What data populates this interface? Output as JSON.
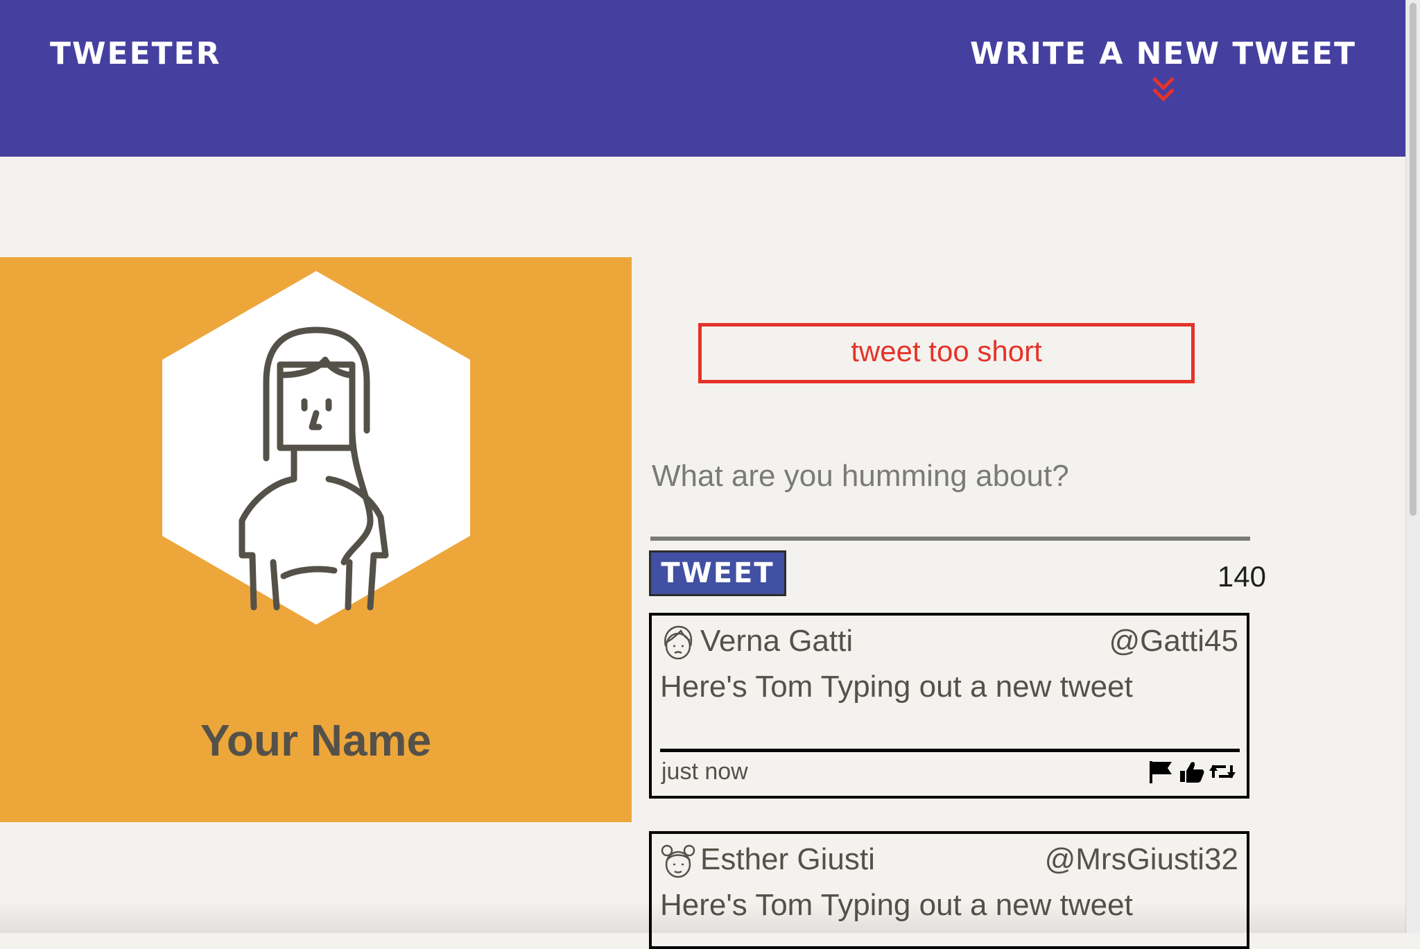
{
  "nav": {
    "brand": "TWEETER",
    "compose_label": "WRITE A NEW TWEET",
    "chevron_icon": "double-chevron-down-icon",
    "background": "#4540a0",
    "chevron_color": "#e5332a"
  },
  "profile": {
    "name": "Your Name",
    "avatar_icon": "woman-avatar-icon",
    "background": "#eda63a"
  },
  "compose": {
    "error_message": "tweet too short",
    "placeholder": "What are you humming about?",
    "button_label": "TWEET",
    "char_count": "140"
  },
  "tweets": [
    {
      "name": "Verna Gatti",
      "handle": "@Gatti45",
      "text": "Here's Tom Typing out a new tweet",
      "time": "just now",
      "avatar_icon": "user-avatar-icon",
      "actions": [
        "flag-icon",
        "like-icon",
        "retweet-icon"
      ]
    },
    {
      "name": "Esther Giusti",
      "handle": "@MrsGiusti32",
      "text": "Here's Tom Typing out a new tweet",
      "avatar_icon": "user-avatar-icon"
    }
  ]
}
